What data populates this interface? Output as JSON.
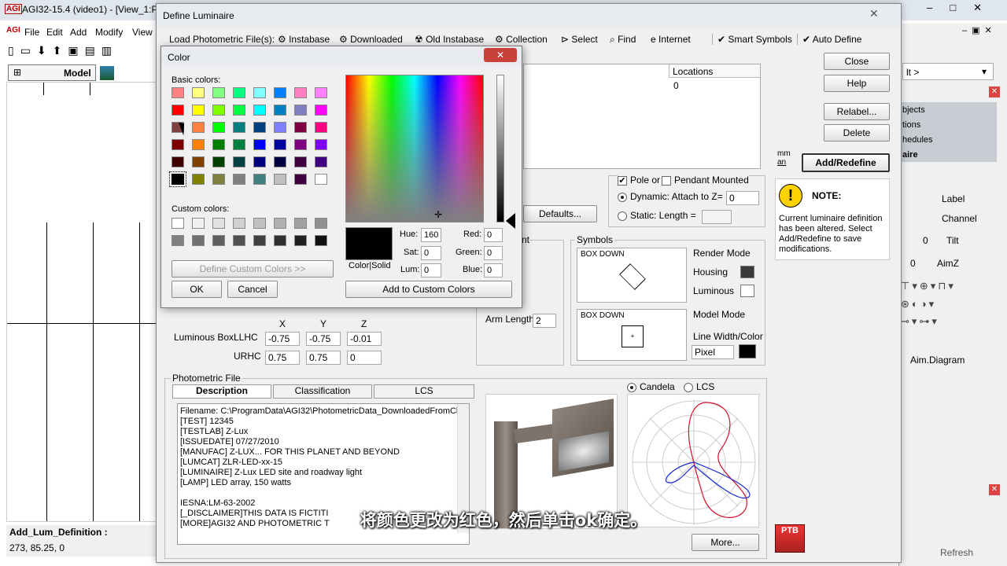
{
  "main_window": {
    "app_icon": "AGI",
    "title": "AGI32-15.4 (video1) - [View_1:Pl",
    "menu": [
      "File",
      "Edit",
      "Add",
      "Modify",
      "View"
    ],
    "view_tab": "Model",
    "status_cmd": "Add_Lum_Definition :",
    "status_coords": "273, 85.25, 0"
  },
  "right_panel": {
    "dropdown": "lt >",
    "items": [
      "bjects",
      "tions",
      "hedules",
      "aire"
    ],
    "rows": [
      "Label",
      "Channel",
      "Tilt",
      "AimZ"
    ],
    "row_values": [
      "0",
      "0"
    ],
    "aim_diagram": "Aim.Diagram",
    "refresh": "Refresh"
  },
  "define_luminaire": {
    "title": "Define Luminaire",
    "toolbar": {
      "load_label": "Load Photometric File(s):",
      "instabase": "Instabase",
      "downloaded": "Downloaded",
      "old_instabase": "Old Instabase",
      "collection": "Collection",
      "select": "Select",
      "find": "Find",
      "internet": "Internet",
      "smart_symbols": "Smart Symbols",
      "auto_define": "Auto Define"
    },
    "buttons": {
      "close": "Close",
      "help": "Help",
      "relabel": "Relabel...",
      "delete": "Delete",
      "add_redefine": "Add/Redefine",
      "defaults": "Defaults...",
      "more": "More..."
    },
    "locations_header": "Locations",
    "locations_value": "0",
    "units": [
      "mm",
      "an"
    ],
    "mounting": {
      "pole_or": "Pole or",
      "pendant_mounted": "Pendant Mounted",
      "dynamic": "Dynamic: Attach to Z=",
      "dynamic_value": "0",
      "static": "Static: Length ="
    },
    "note": {
      "title": "NOTE:",
      "text": "Current luminaire definition has been altered. Select Add/Redefine to save modifications."
    },
    "symbols": {
      "label": "Symbols",
      "box1": "BOX DOWN",
      "box2": "BOX DOWN",
      "render_mode": "Render Mode",
      "housing": "Housing",
      "luminous": "Luminous",
      "model_mode": "Model Mode",
      "line_width": "Line Width/Color",
      "pixel": "Pixel",
      "housing_color": "#3a3a3a",
      "luminous_color": "#ffffff",
      "line_color": "#000000"
    },
    "arm": {
      "label": "Arm Length",
      "value": "2",
      "partial": "nt"
    },
    "luminous_box": {
      "label": "Luminous Box:",
      "llhc": "LLHC",
      "urhc": "URHC",
      "x": "X",
      "y": "Y",
      "z": "Z",
      "llhc_vals": [
        "-0.75",
        "-0.75",
        "-0.01"
      ],
      "urhc_vals": [
        "0.75",
        "0.75",
        "0"
      ]
    },
    "photometric": {
      "label": "Photometric File",
      "tabs": [
        "Description",
        "Classification",
        "LCS"
      ],
      "lines": [
        "Filename: C:\\ProgramData\\AGI32\\PhotometricData_DownloadedFromCl",
        "[TEST] 12345",
        "[TESTLAB] Z-Lux",
        "[ISSUEDATE] 07/27/2010",
        "[MANUFAC] Z-LUX... FOR THIS PLANET AND BEYOND",
        "[LUMCAT] ZLR-LED-xx-15",
        "[LUMINAIRE] Z-Lux LED site and roadway light",
        "[LAMP] LED array, 150 watts",
        "",
        "IESNA:LM-63-2002",
        "[_DISCLAIMER]THIS DATA IS FICTITI",
        "[MORE]AGI32 AND PHOTOMETRIC T"
      ]
    },
    "candela": "Candela",
    "lcs": "LCS"
  },
  "color_dialog": {
    "title": "Color",
    "basic_label": "Basic colors:",
    "custom_label": "Custom colors:",
    "define_custom": "Define Custom Colors >>",
    "ok": "OK",
    "cancel": "Cancel",
    "color_solid": "Color|Solid",
    "hue_label": "Hue:",
    "hue": "160",
    "sat_label": "Sat:",
    "sat": "0",
    "lum_label": "Lum:",
    "lum": "0",
    "red_label": "Red:",
    "red": "0",
    "green_label": "Green:",
    "green": "0",
    "blue_label": "Blue:",
    "blue": "0",
    "add_custom": "Add to Custom Colors",
    "basic_colors": [
      "#ff8080",
      "#ffff80",
      "#80ff80",
      "#00ff80",
      "#80ffff",
      "#0080ff",
      "#ff80c0",
      "#ff80ff",
      "#ff0000",
      "#ffff00",
      "#80ff00",
      "#00ff40",
      "#00ffff",
      "#0080c0",
      "#8080c0",
      "#ff00ff",
      "#804040",
      "#ff8040",
      "#00ff00",
      "#008080",
      "#004080",
      "#8080ff",
      "#800040",
      "#ff0080",
      "#800000",
      "#ff8000",
      "#008000",
      "#008040",
      "#0000ff",
      "#0000a0",
      "#800080",
      "#8000ff",
      "#400000",
      "#804000",
      "#004000",
      "#004040",
      "#000080",
      "#000040",
      "#400040",
      "#400080",
      "#000000",
      "#808000",
      "#808040",
      "#808080",
      "#408080",
      "#c0c0c0",
      "#400040",
      "#ffffff"
    ],
    "custom_colors": [
      "#ffffff",
      "#f0f0f0",
      "#e0e0e0",
      "#d0d0d0",
      "#c0c0c0",
      "#b0b0b0",
      "#a0a0a0",
      "#909090",
      "#808080",
      "#707070",
      "#606060",
      "#505050",
      "#404040",
      "#303030",
      "#202020",
      "#101010"
    ]
  },
  "subtitle": "将颜色更改为红色，然后单击ok确定。"
}
